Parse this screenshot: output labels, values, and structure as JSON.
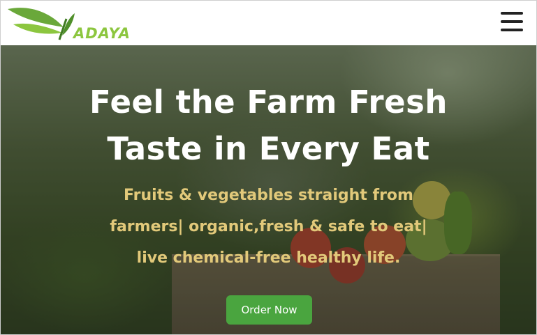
{
  "header": {
    "logo_text": "ADAYA",
    "menu_icon": "hamburger-menu-icon"
  },
  "hero": {
    "title_line1": "Feel the Farm Fresh",
    "title_line2": "Taste in Every Eat",
    "subtitle_line1": "Fruits & vegetables straight from",
    "subtitle_line2": "farmers| organic,fresh & safe to eat|",
    "subtitle_line3": "live chemical-free healthy life.",
    "cta_label": "Order Now"
  },
  "colors": {
    "brand_green": "#8cc63f",
    "cta_green": "#4aa53f",
    "subtitle_gold": "#e2c97a",
    "title_white": "#ffffff",
    "menu_icon": "#222222"
  }
}
